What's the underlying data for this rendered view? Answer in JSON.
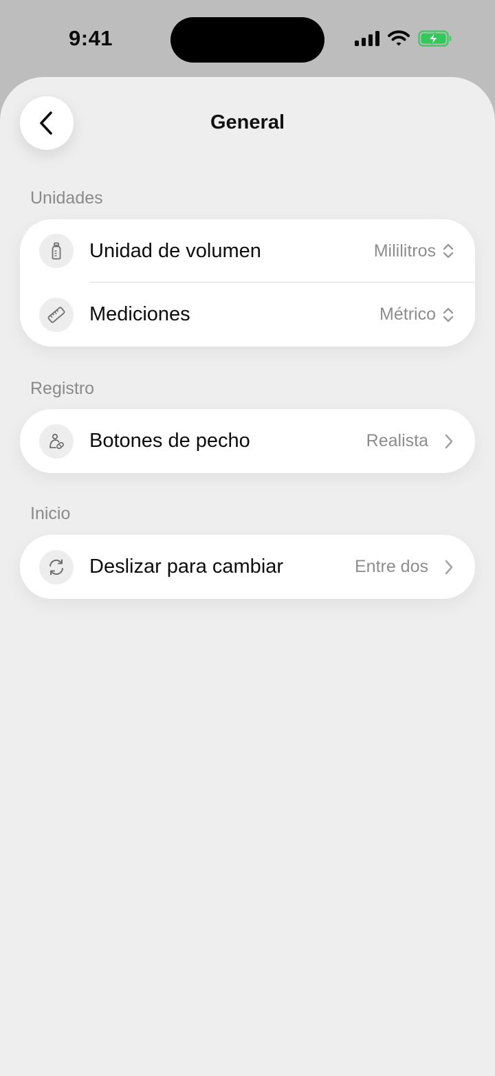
{
  "status_bar": {
    "time": "9:41",
    "icons": [
      "cellular-signal-icon",
      "wifi-icon",
      "battery-charging-icon"
    ],
    "battery_color": "#34c759"
  },
  "header": {
    "title": "General",
    "back_icon": "chevron-left-icon"
  },
  "sections": [
    {
      "label": "Unidades",
      "rows": [
        {
          "icon": "bottle-icon",
          "label": "Unidad de volumen",
          "value": "Mililitros",
          "accessory": "updown-chevron-icon"
        },
        {
          "icon": "ruler-icon",
          "label": "Mediciones",
          "value": "Métrico",
          "accessory": "updown-chevron-icon"
        }
      ]
    },
    {
      "label": "Registro",
      "rows": [
        {
          "icon": "breast-pump-icon",
          "label": "Botones de pecho",
          "value": "Realista",
          "accessory": "chevron-right-icon"
        }
      ]
    },
    {
      "label": "Inicio",
      "rows": [
        {
          "icon": "refresh-icon",
          "label": "Deslizar para cambiar",
          "value": "Entre dos",
          "accessory": "chevron-right-icon"
        }
      ]
    }
  ],
  "colors": {
    "sheet_background": "#eeeeee",
    "card_background": "#ffffff",
    "secondary_text": "#8d8d8d"
  }
}
